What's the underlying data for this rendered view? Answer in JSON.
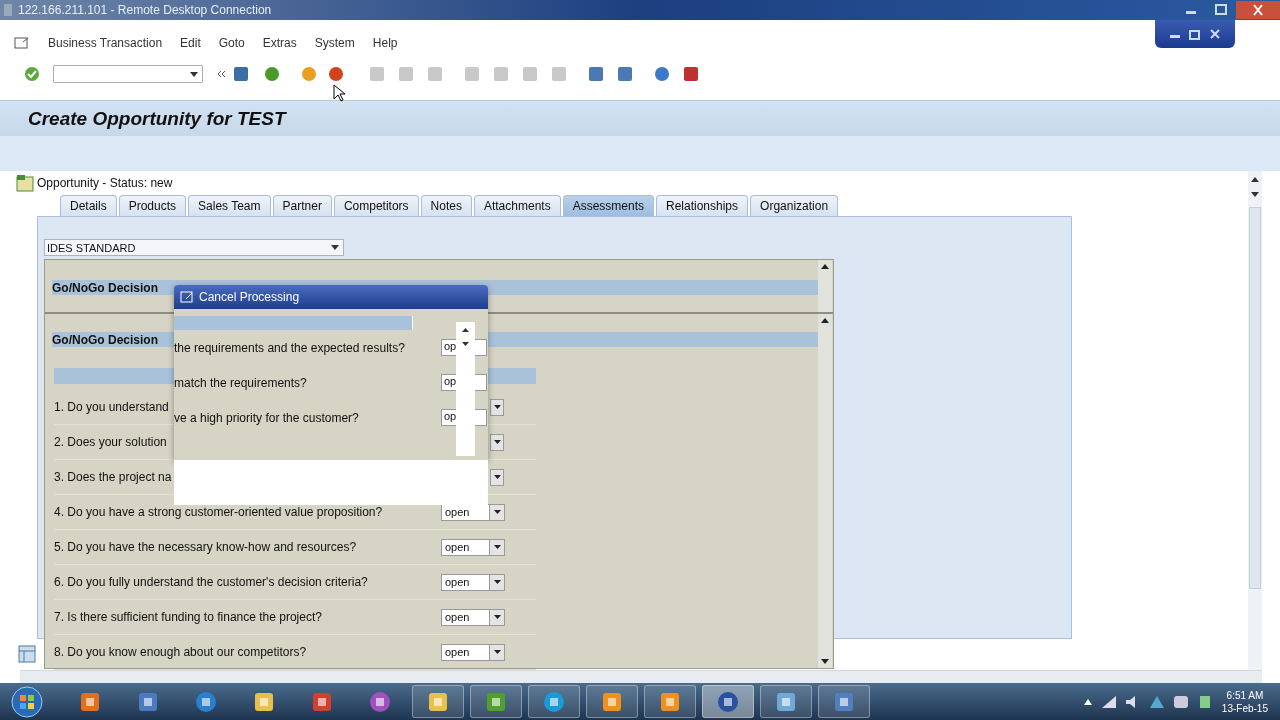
{
  "remote_window": {
    "title": "122.166.211.101 - Remote Desktop Connection"
  },
  "menu": [
    "Business Transaction",
    "Edit",
    "Goto",
    "Extras",
    "System",
    "Help"
  ],
  "screen_title": "Create Opportunity for TEST",
  "header": {
    "label": "Opportunity - Status: new"
  },
  "tabs": [
    {
      "label": "Details",
      "selected": false
    },
    {
      "label": "Products",
      "selected": false
    },
    {
      "label": "Sales Team",
      "selected": false
    },
    {
      "label": "Partner",
      "selected": false
    },
    {
      "label": "Competitors",
      "selected": false
    },
    {
      "label": "Notes",
      "selected": false
    },
    {
      "label": "Attachments",
      "selected": false
    },
    {
      "label": "Assessments",
      "selected": true
    },
    {
      "label": "Relationships",
      "selected": false
    },
    {
      "label": "Organization",
      "selected": false
    }
  ],
  "assessment_select": {
    "value": "IDES STANDARD"
  },
  "sections": [
    {
      "title": "Go/NoGo Decision"
    },
    {
      "title": "Go/NoGo Decision",
      "questions": [
        {
          "text": "1. Do you understand"
        },
        {
          "text": "2. Does your solution"
        },
        {
          "text": "3. Does the project na"
        },
        {
          "text": "4. Do you have a strong customer-oriented value proposition?",
          "answer": "open"
        },
        {
          "text": "5. Do you have the necessary know-how and resources?",
          "answer": "open"
        },
        {
          "text": "6. Do you fully understand the customer's decision criteria?",
          "answer": "open"
        },
        {
          "text": "7. Is there sufficient funding to finance the project?",
          "answer": "open"
        },
        {
          "text": "8. Do you know enough about our competitors?",
          "answer": "open"
        }
      ]
    }
  ],
  "popup": {
    "title": "Cancel Processing",
    "rows": [
      {
        "text": "the requirements and the expected results?",
        "answer": "op"
      },
      {
        "text": "match the requirements?",
        "answer": "op"
      },
      {
        "text": "ve a high priority for the customer?",
        "answer": "op"
      }
    ]
  },
  "taskbar": {
    "buttons": [
      {
        "running": false,
        "active": false
      },
      {
        "running": false,
        "active": false
      },
      {
        "running": false,
        "active": false
      },
      {
        "running": false,
        "active": false
      },
      {
        "running": false,
        "active": false
      },
      {
        "running": false,
        "active": false
      },
      {
        "running": true,
        "active": false
      },
      {
        "running": true,
        "active": false
      },
      {
        "running": true,
        "active": false
      },
      {
        "running": true,
        "active": false
      },
      {
        "running": true,
        "active": false
      },
      {
        "running": true,
        "active": true
      },
      {
        "running": true,
        "active": false
      },
      {
        "running": true,
        "active": false
      }
    ],
    "time": "6:51 AM",
    "date": "13-Feb-15"
  }
}
